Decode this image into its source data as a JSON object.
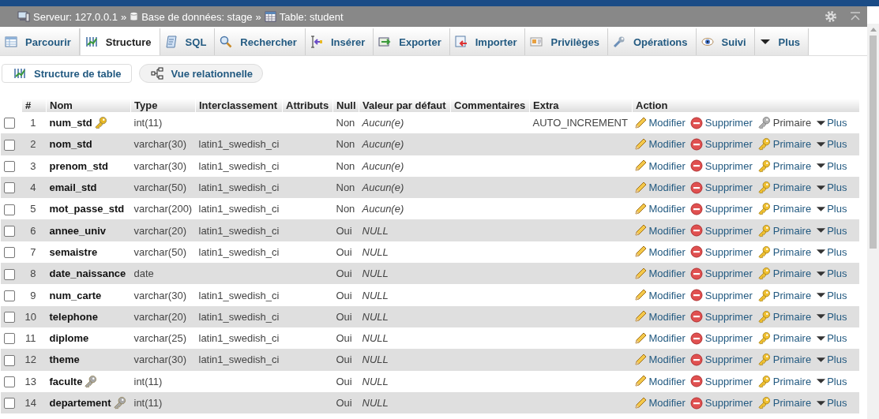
{
  "breadcrumb": [
    {
      "label": "Serveur: 127.0.0.1"
    },
    {
      "label": "Base de données: stage"
    },
    {
      "label": "Table: student"
    }
  ],
  "breadcrumb_separators": [
    "»",
    "»"
  ],
  "tabs": [
    {
      "label": "Parcourir",
      "selected": false
    },
    {
      "label": "Structure",
      "selected": true
    },
    {
      "label": "SQL",
      "selected": false
    },
    {
      "label": "Rechercher",
      "selected": false
    },
    {
      "label": "Insérer",
      "selected": false
    },
    {
      "label": "Exporter",
      "selected": false
    },
    {
      "label": "Importer",
      "selected": false
    },
    {
      "label": "Privilèges",
      "selected": false
    },
    {
      "label": "Opérations",
      "selected": false
    },
    {
      "label": "Suivi",
      "selected": false
    },
    {
      "label": "Plus",
      "selected": false
    }
  ],
  "subtabs": [
    {
      "label": "Structure de table",
      "selected": true
    },
    {
      "label": "Vue relationnelle",
      "selected": false
    }
  ],
  "table": {
    "columns": [
      "#",
      "Nom",
      "Type",
      "Interclassement",
      "Attributs",
      "Null",
      "Valeur par défaut",
      "Commentaires",
      "Extra",
      "Action"
    ],
    "rows": [
      {
        "index": "1",
        "name": "num_std",
        "kind": "primary_key",
        "type": "int(11)",
        "collation": "",
        "null": "Non",
        "default": "Aucun(e)",
        "extra": "AUTO_INCREMENT",
        "checked": false,
        "primary_disabled": true,
        "edit": "Modifier",
        "drop": "Supprimer",
        "primary": "Primaire",
        "more": "Plus"
      },
      {
        "index": "2",
        "name": "nom_std",
        "kind": "plain",
        "type": "varchar(30)",
        "collation": "latin1_swedish_ci",
        "null": "Non",
        "default": "Aucun(e)",
        "extra": "",
        "checked": false,
        "primary_disabled": false,
        "edit": "Modifier",
        "drop": "Supprimer",
        "primary": "Primaire",
        "more": "Plus"
      },
      {
        "index": "3",
        "name": "prenom_std",
        "kind": "plain",
        "type": "varchar(30)",
        "collation": "latin1_swedish_ci",
        "null": "Non",
        "default": "Aucun(e)",
        "extra": "",
        "checked": false,
        "primary_disabled": false,
        "edit": "Modifier",
        "drop": "Supprimer",
        "primary": "Primaire",
        "more": "Plus"
      },
      {
        "index": "4",
        "name": "email_std",
        "kind": "plain",
        "type": "varchar(50)",
        "collation": "latin1_swedish_ci",
        "null": "Non",
        "default": "Aucun(e)",
        "extra": "",
        "checked": false,
        "primary_disabled": false,
        "edit": "Modifier",
        "drop": "Supprimer",
        "primary": "Primaire",
        "more": "Plus"
      },
      {
        "index": "5",
        "name": "mot_passe_std",
        "kind": "plain",
        "type": "varchar(200)",
        "collation": "latin1_swedish_ci",
        "null": "Non",
        "default": "Aucun(e)",
        "extra": "",
        "checked": false,
        "primary_disabled": false,
        "edit": "Modifier",
        "drop": "Supprimer",
        "primary": "Primaire",
        "more": "Plus"
      },
      {
        "index": "6",
        "name": "annee_univ",
        "kind": "plain",
        "type": "varchar(20)",
        "collation": "latin1_swedish_ci",
        "null": "Oui",
        "default": "NULL",
        "extra": "",
        "checked": false,
        "primary_disabled": false,
        "edit": "Modifier",
        "drop": "Supprimer",
        "primary": "Primaire",
        "more": "Plus"
      },
      {
        "index": "7",
        "name": "semaistre",
        "kind": "plain",
        "type": "varchar(50)",
        "collation": "latin1_swedish_ci",
        "null": "Oui",
        "default": "NULL",
        "extra": "",
        "checked": false,
        "primary_disabled": false,
        "edit": "Modifier",
        "drop": "Supprimer",
        "primary": "Primaire",
        "more": "Plus"
      },
      {
        "index": "8",
        "name": "date_naissance",
        "kind": "plain",
        "type": "date",
        "collation": "",
        "null": "Oui",
        "default": "NULL",
        "extra": "",
        "checked": false,
        "primary_disabled": false,
        "edit": "Modifier",
        "drop": "Supprimer",
        "primary": "Primaire",
        "more": "Plus"
      },
      {
        "index": "9",
        "name": "num_carte",
        "kind": "plain",
        "type": "varchar(30)",
        "collation": "latin1_swedish_ci",
        "null": "Oui",
        "default": "NULL",
        "extra": "",
        "checked": false,
        "primary_disabled": false,
        "edit": "Modifier",
        "drop": "Supprimer",
        "primary": "Primaire",
        "more": "Plus"
      },
      {
        "index": "10",
        "name": "telephone",
        "kind": "plain",
        "type": "varchar(20)",
        "collation": "latin1_swedish_ci",
        "null": "Oui",
        "default": "NULL",
        "extra": "",
        "checked": false,
        "primary_disabled": false,
        "edit": "Modifier",
        "drop": "Supprimer",
        "primary": "Primaire",
        "more": "Plus"
      },
      {
        "index": "11",
        "name": "diplome",
        "kind": "plain",
        "type": "varchar(25)",
        "collation": "latin1_swedish_ci",
        "null": "Oui",
        "default": "NULL",
        "extra": "",
        "checked": false,
        "primary_disabled": false,
        "edit": "Modifier",
        "drop": "Supprimer",
        "primary": "Primaire",
        "more": "Plus"
      },
      {
        "index": "12",
        "name": "theme",
        "kind": "plain",
        "type": "varchar(30)",
        "collation": "latin1_swedish_ci",
        "null": "Oui",
        "default": "NULL",
        "extra": "",
        "checked": false,
        "primary_disabled": false,
        "edit": "Modifier",
        "drop": "Supprimer",
        "primary": "Primaire",
        "more": "Plus"
      },
      {
        "index": "13",
        "name": "faculte",
        "kind": "index",
        "type": "int(11)",
        "collation": "",
        "null": "Oui",
        "default": "NULL",
        "extra": "",
        "checked": false,
        "primary_disabled": false,
        "edit": "Modifier",
        "drop": "Supprimer",
        "primary": "Primaire",
        "more": "Plus"
      },
      {
        "index": "14",
        "name": "departement",
        "kind": "index",
        "type": "int(11)",
        "collation": "",
        "null": "Oui",
        "default": "NULL",
        "extra": "",
        "checked": false,
        "primary_disabled": false,
        "edit": "Modifier",
        "drop": "Supprimer",
        "primary": "Primaire",
        "more": "Plus"
      }
    ]
  }
}
